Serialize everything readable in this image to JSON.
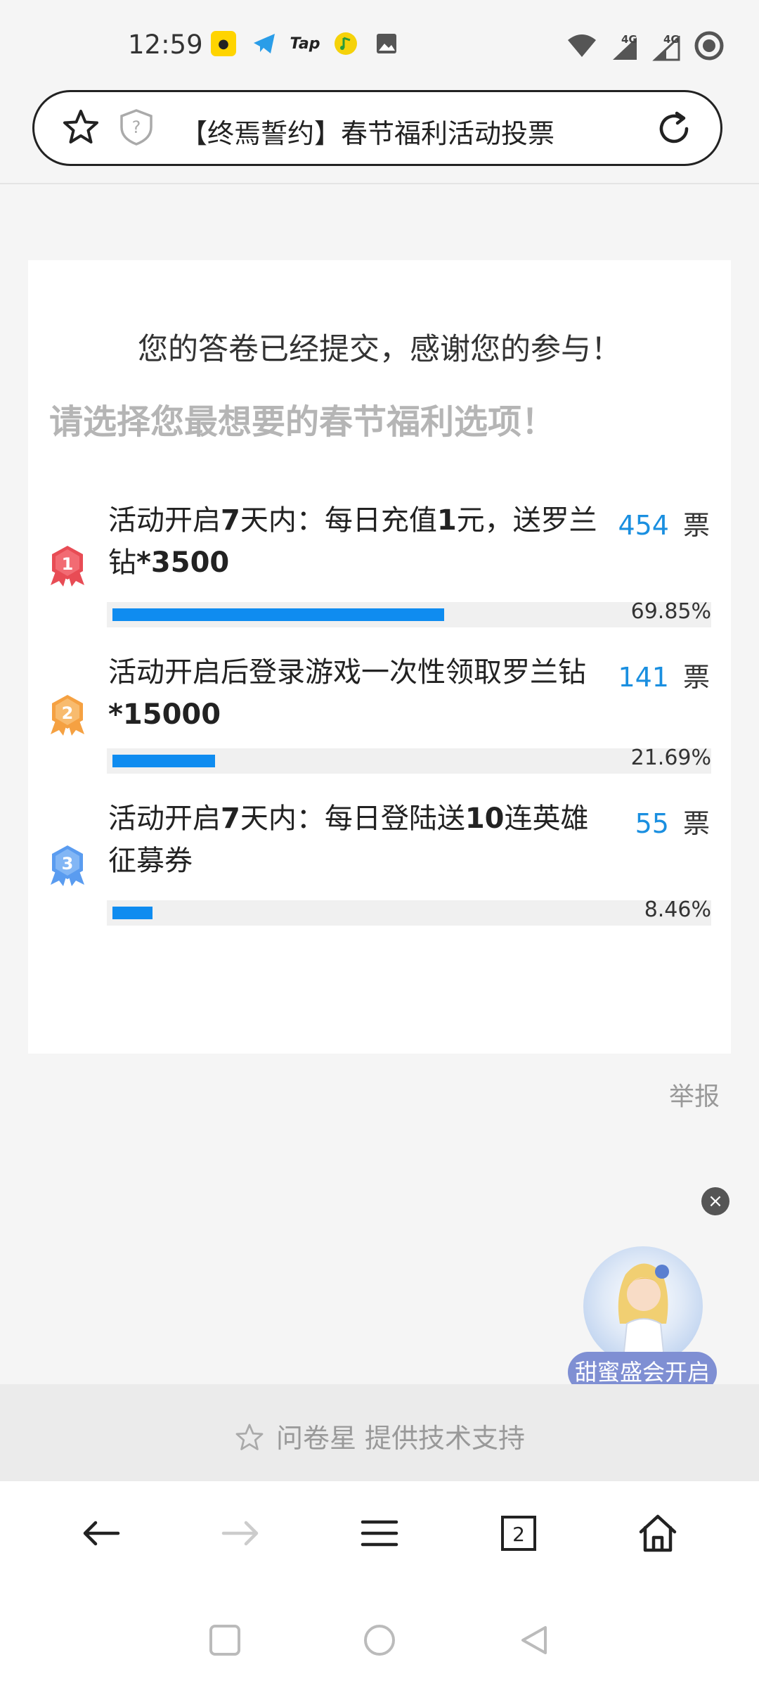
{
  "status_bar": {
    "time": "12:59",
    "apps": [
      "bunny-app-icon",
      "telegram-icon",
      "taptap-icon",
      "qq-music-icon",
      "gallery-icon"
    ],
    "tap_label": "Tap",
    "network": [
      "4G",
      "4G"
    ]
  },
  "address_bar": {
    "title": "【终焉誓约】春节福利活动投票"
  },
  "survey": {
    "thanks": "您的答卷已经提交，感谢您的参与！",
    "question": "请选择您最想要的春节福利选项！",
    "options": [
      {
        "rank": "1",
        "text_a": "活动开启",
        "text_b": "7",
        "text_c": "天内：每日充值",
        "text_d": "1",
        "text_e": "元，送罗兰钻",
        "text_f": "*3500",
        "votes": "454",
        "unit": "票",
        "percent": "69.85%",
        "fraction": 0.6985
      },
      {
        "rank": "2",
        "text_a": "活动开启后登录游戏一次性领取罗兰钻",
        "text_b": "*15000",
        "votes": "141",
        "unit": "票",
        "percent": "21.69%",
        "fraction": 0.2169
      },
      {
        "rank": "3",
        "text_a": "活动开启",
        "text_b": "7",
        "text_c": "天内：每日登陆送",
        "text_d": "10",
        "text_e": "连英雄征募券",
        "votes": "55",
        "unit": "票",
        "percent": "8.46%",
        "fraction": 0.0846
      }
    ],
    "report": "举报"
  },
  "promo": {
    "label": "甜蜜盛会开启",
    "close": "×"
  },
  "footer": {
    "text": "问卷星 提供技术支持"
  },
  "browser_nav": {
    "tab_count": "2"
  },
  "colors": {
    "accent": "#0f8cf0",
    "vote_number": "#1a8fe0",
    "medal_1": "#e84c55",
    "medal_2": "#f5a142",
    "medal_3": "#5a9cf0"
  }
}
